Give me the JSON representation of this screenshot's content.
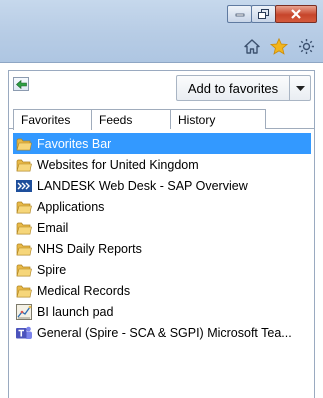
{
  "toolbar": {
    "add_to_favorites_label": "Add to favorites"
  },
  "tabs": [
    {
      "label": "Favorites",
      "selected": true
    },
    {
      "label": "Feeds",
      "selected": false
    },
    {
      "label": "History",
      "selected": false
    }
  ],
  "items": [
    {
      "label": "Favorites Bar",
      "icon": "folder-icon",
      "selected": true
    },
    {
      "label": "Websites for United Kingdom",
      "icon": "folder-icon",
      "selected": false
    },
    {
      "label": "LANDESK Web Desk - SAP Overview",
      "icon": "landesk-icon",
      "selected": false
    },
    {
      "label": "Applications",
      "icon": "folder-icon",
      "selected": false
    },
    {
      "label": "Email",
      "icon": "folder-icon",
      "selected": false
    },
    {
      "label": "NHS Daily Reports",
      "icon": "folder-icon",
      "selected": false
    },
    {
      "label": "Spire",
      "icon": "folder-icon",
      "selected": false
    },
    {
      "label": "Medical Records",
      "icon": "folder-icon",
      "selected": false
    },
    {
      "label": "BI launch pad",
      "icon": "bi-launchpad-icon",
      "selected": false
    },
    {
      "label": "General (Spire - SCA & SGPI)  Microsoft Tea...",
      "icon": "teams-icon",
      "selected": false
    }
  ],
  "colors": {
    "selection": "#3399ff",
    "folder": "#e8b948",
    "star": "#f2b51c"
  }
}
